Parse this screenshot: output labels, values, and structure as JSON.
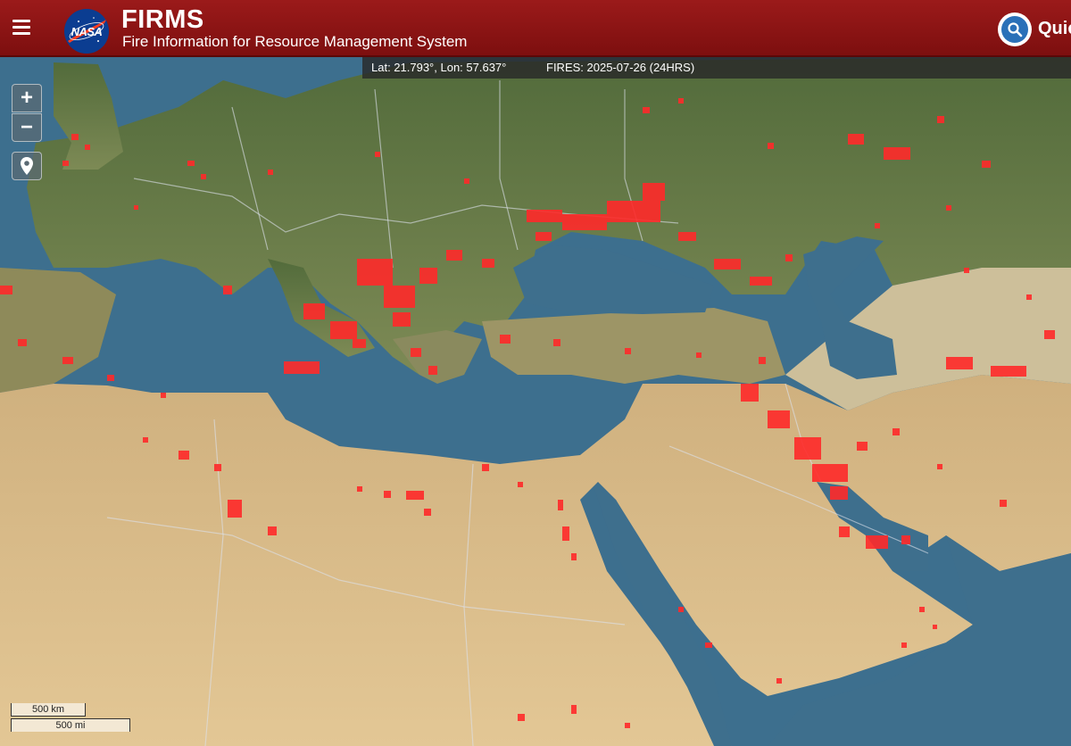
{
  "header": {
    "logo_text": "NASA",
    "title": "FIRMS",
    "subtitle": "Fire Information for Resource Management System",
    "quick_label": "Quic"
  },
  "status": {
    "coords": "Lat: 21.793°, Lon: 57.637°",
    "fires": "FIRES: 2025-07-26 (24HRS)"
  },
  "controls": {
    "zoom_in": "+",
    "zoom_out": "−"
  },
  "scale": {
    "km": "500 km",
    "mi": "500 mi"
  },
  "icons": {
    "menu": "hamburger-icon",
    "search": "search-icon",
    "locate": "map-pin-icon"
  },
  "colors": {
    "header": "#8b1414",
    "fire": "#ff2a2a",
    "sea": "#3d6f8e",
    "land": "#5f7a45",
    "desert": "#d9b888"
  }
}
